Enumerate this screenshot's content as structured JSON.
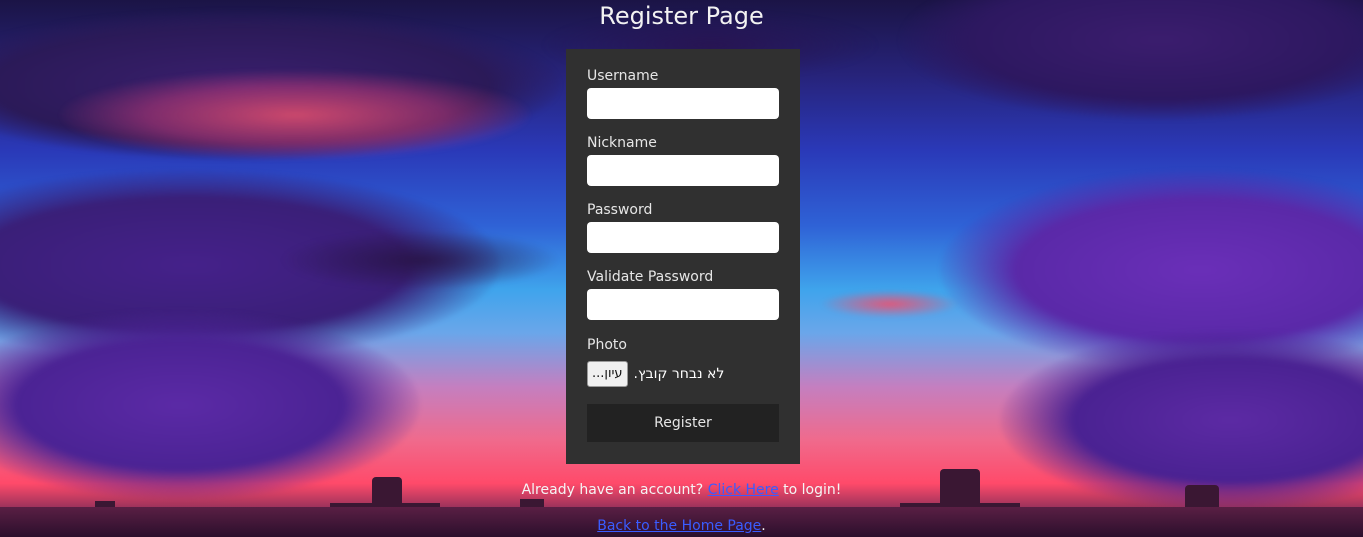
{
  "page": {
    "title": "Register Page"
  },
  "form": {
    "username_label": "Username",
    "username_value": "",
    "nickname_label": "Nickname",
    "nickname_value": "",
    "password_label": "Password",
    "password_value": "",
    "validate_password_label": "Validate Password",
    "validate_password_value": "",
    "photo_label": "Photo",
    "file_button_label": "עיון...",
    "file_status": "לא נבחר קובץ.",
    "register_button_label": "Register"
  },
  "footer": {
    "login_prefix": "Already have an account?",
    "login_link": "Click Here",
    "login_suffix": "to login!",
    "home_link": "Back to the Home Page",
    "home_suffix": "."
  },
  "colors": {
    "panel": "#303030",
    "button": "#222222",
    "link": "#3a5cff"
  }
}
